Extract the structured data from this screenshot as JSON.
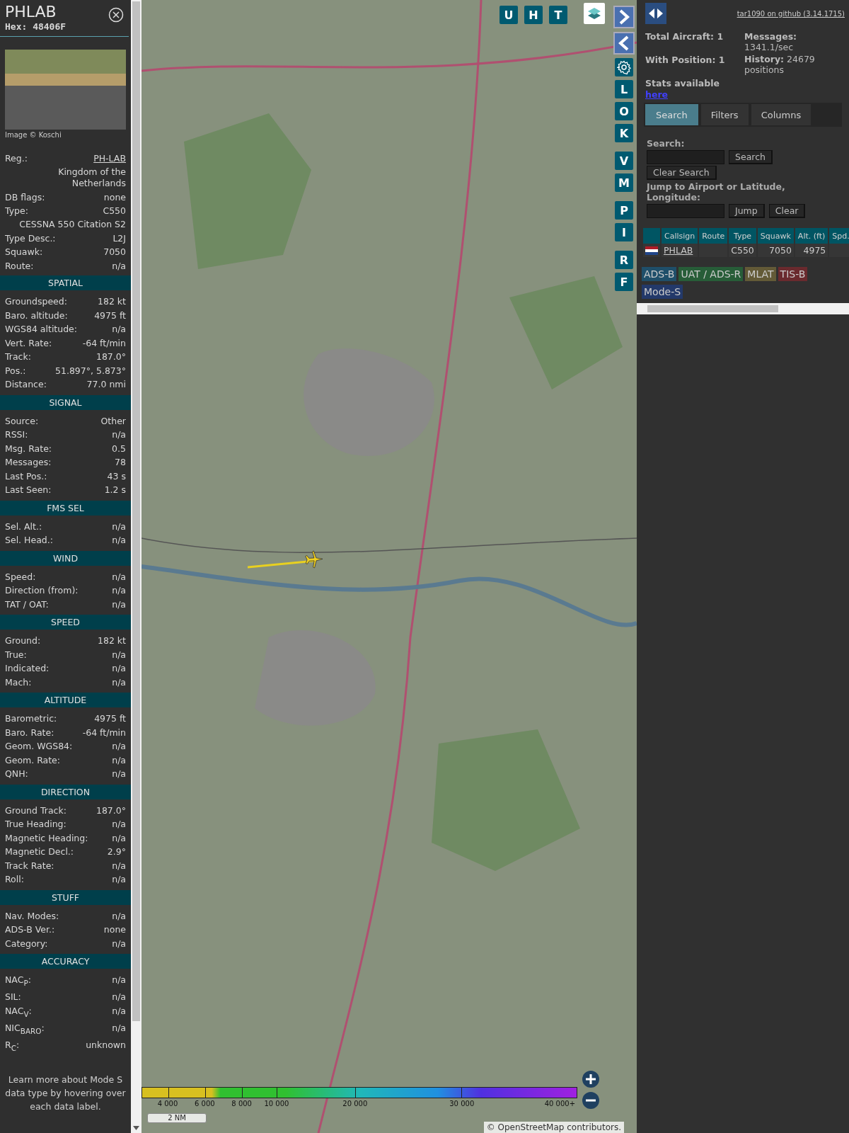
{
  "detail": {
    "title": "PHLAB",
    "hex": "Hex: 48406F",
    "photo_credit": "Image © Koschi",
    "rows": [
      {
        "label": "Reg.:",
        "value": "PH-LAB",
        "kind": "link"
      },
      {
        "value": "Kingdom of the Netherlands",
        "kind": "text"
      },
      {
        "label": "DB flags:",
        "value": "none",
        "kind": "text"
      },
      {
        "label": "Type:",
        "value": "C550",
        "kind": "text"
      },
      {
        "value": "CESSNA 550 Citation S2",
        "kind": "text"
      },
      {
        "label": "Type Desc.:",
        "value": "L2J",
        "kind": "text"
      },
      {
        "label": "Squawk:",
        "value": "7050",
        "kind": "text"
      },
      {
        "label": "Route:",
        "value": "n/a",
        "kind": "text"
      }
    ],
    "sections": [
      {
        "title": "SPATIAL",
        "rows": [
          {
            "label": "Groundspeed:",
            "value": "182 kt"
          },
          {
            "label": "Baro. altitude:",
            "value": "4975 ft"
          },
          {
            "label": "WGS84 altitude:",
            "value": "n/a"
          },
          {
            "label": "Vert. Rate:",
            "value": "-64 ft/min"
          },
          {
            "label": "Track:",
            "value": "187.0°"
          },
          {
            "label": "Pos.:",
            "value": "51.897°, 5.873°"
          },
          {
            "label": "Distance:",
            "value": "77.0 nmi"
          }
        ]
      },
      {
        "title": "SIGNAL",
        "rows": [
          {
            "label": "Source:",
            "value": "Other"
          },
          {
            "label": "RSSI:",
            "value": "n/a"
          },
          {
            "label": "Msg. Rate:",
            "value": "0.5"
          },
          {
            "label": "Messages:",
            "value": "78"
          },
          {
            "label": "Last Pos.:",
            "value": "43 s"
          },
          {
            "label": "Last Seen:",
            "value": "1.2 s"
          }
        ]
      },
      {
        "title": "FMS SEL",
        "rows": [
          {
            "label": "Sel. Alt.:",
            "value": "n/a"
          },
          {
            "label": "Sel. Head.:",
            "value": "n/a"
          }
        ]
      },
      {
        "title": "WIND",
        "rows": [
          {
            "label": "Speed:",
            "value": "n/a"
          },
          {
            "label": "Direction (from):",
            "value": "n/a"
          },
          {
            "label": "TAT / OAT:",
            "value": "n/a"
          }
        ]
      },
      {
        "title": "SPEED",
        "rows": [
          {
            "label": "Ground:",
            "value": "182 kt"
          },
          {
            "label": "True:",
            "value": "n/a"
          },
          {
            "label": "Indicated:",
            "value": "n/a"
          },
          {
            "label": "Mach:",
            "value": "n/a"
          }
        ]
      },
      {
        "title": "ALTITUDE",
        "rows": [
          {
            "label": "Barometric:",
            "value": "4975 ft"
          },
          {
            "label": "Baro. Rate:",
            "value": "-64 ft/min"
          },
          {
            "label": "Geom. WGS84:",
            "value": "n/a"
          },
          {
            "label": "Geom. Rate:",
            "value": "n/a"
          },
          {
            "label": "QNH:",
            "value": "n/a"
          }
        ]
      },
      {
        "title": "DIRECTION",
        "rows": [
          {
            "label": "Ground Track:",
            "value": "187.0°"
          },
          {
            "label": "True Heading:",
            "value": "n/a"
          },
          {
            "label": "Magnetic Heading:",
            "value": "n/a"
          },
          {
            "label": "Magnetic Decl.:",
            "value": "2.9°"
          },
          {
            "label": "Track Rate:",
            "value": "n/a"
          },
          {
            "label": "Roll:",
            "value": "n/a"
          }
        ]
      },
      {
        "title": "STUFF",
        "rows": [
          {
            "label": "Nav. Modes:",
            "value": "n/a"
          },
          {
            "label": "ADS-B Ver.:",
            "value": "none"
          },
          {
            "label": "Category:",
            "value": "n/a"
          }
        ]
      },
      {
        "title": "ACCURACY",
        "rows": [
          {
            "label": "NAC$_{P}$:",
            "value": "n/a"
          },
          {
            "label": "SIL:",
            "value": "n/a"
          },
          {
            "label": "NAC$_{V}$:",
            "value": "n/a"
          },
          {
            "label": "NIC$_{BARO}$:",
            "value": "n/a"
          },
          {
            "label": "R$_{C}$:",
            "value": "unknown"
          }
        ]
      }
    ],
    "note": "Learn more about Mode S data type by hovering over each data label."
  },
  "map": {
    "top_buttons": [
      "U",
      "H",
      "T"
    ],
    "side_buttons": [
      {
        "kind": "next"
      },
      {
        "kind": "prev"
      },
      {
        "kind": "gear"
      },
      {
        "kind": "letter",
        "label": "L"
      },
      {
        "kind": "letter",
        "label": "O"
      },
      {
        "kind": "letter",
        "label": "K"
      },
      {
        "kind": "letter",
        "label": "V"
      },
      {
        "kind": "letter",
        "label": "M"
      },
      {
        "kind": "letter",
        "label": "P"
      },
      {
        "kind": "letter",
        "label": "I"
      },
      {
        "kind": "letter",
        "label": "R"
      },
      {
        "kind": "letter",
        "label": "F"
      }
    ],
    "legend_ticks": [
      "4 000",
      "6 000",
      "8 000",
      "10 000",
      "20 000",
      "30 000",
      "40 000+"
    ],
    "scale": "2 NM",
    "attribution": "© OpenStreetMap contributors."
  },
  "sidebar": {
    "github_link": "tar1090 on github (3.14.1715)",
    "stats_left": [
      "Total Aircraft: 1",
      "With Position: 1",
      "Stats available"
    ],
    "stats_link": "here",
    "stats_right": [
      "**Messages:** 1341.1/sec",
      "**History:** 24679 positions"
    ],
    "tabs": [
      {
        "label": "Search",
        "selected": true
      },
      {
        "label": "Filters",
        "selected": false
      },
      {
        "label": "Columns",
        "selected": false
      }
    ],
    "search_label": "Search:",
    "search_button": "Search",
    "clear_search_button": "Clear Search",
    "jump_label": "Jump to Airport or Latitude, Longitude:",
    "jump_button": "Jump",
    "clear_button": "Clear",
    "table": {
      "columns": [
        "Callsign",
        "Route",
        "Type",
        "Squawk",
        "Alt. (ft)",
        "Spd."
      ],
      "rows": [
        {
          "cells": [
            "PHLAB",
            null,
            "C550",
            "7050",
            "4975",
            null
          ]
        }
      ]
    },
    "sources": [
      {
        "label": "ADS-B",
        "color": "#1f4f6a"
      },
      {
        "label": "UAT / ADS-R",
        "color": "#275d38"
      },
      {
        "label": "MLAT",
        "color": "#635a37"
      },
      {
        "label": "TIS-B",
        "color": "#6a2a2e"
      },
      {
        "label": "Mode-S",
        "color": "#23396a"
      }
    ]
  }
}
